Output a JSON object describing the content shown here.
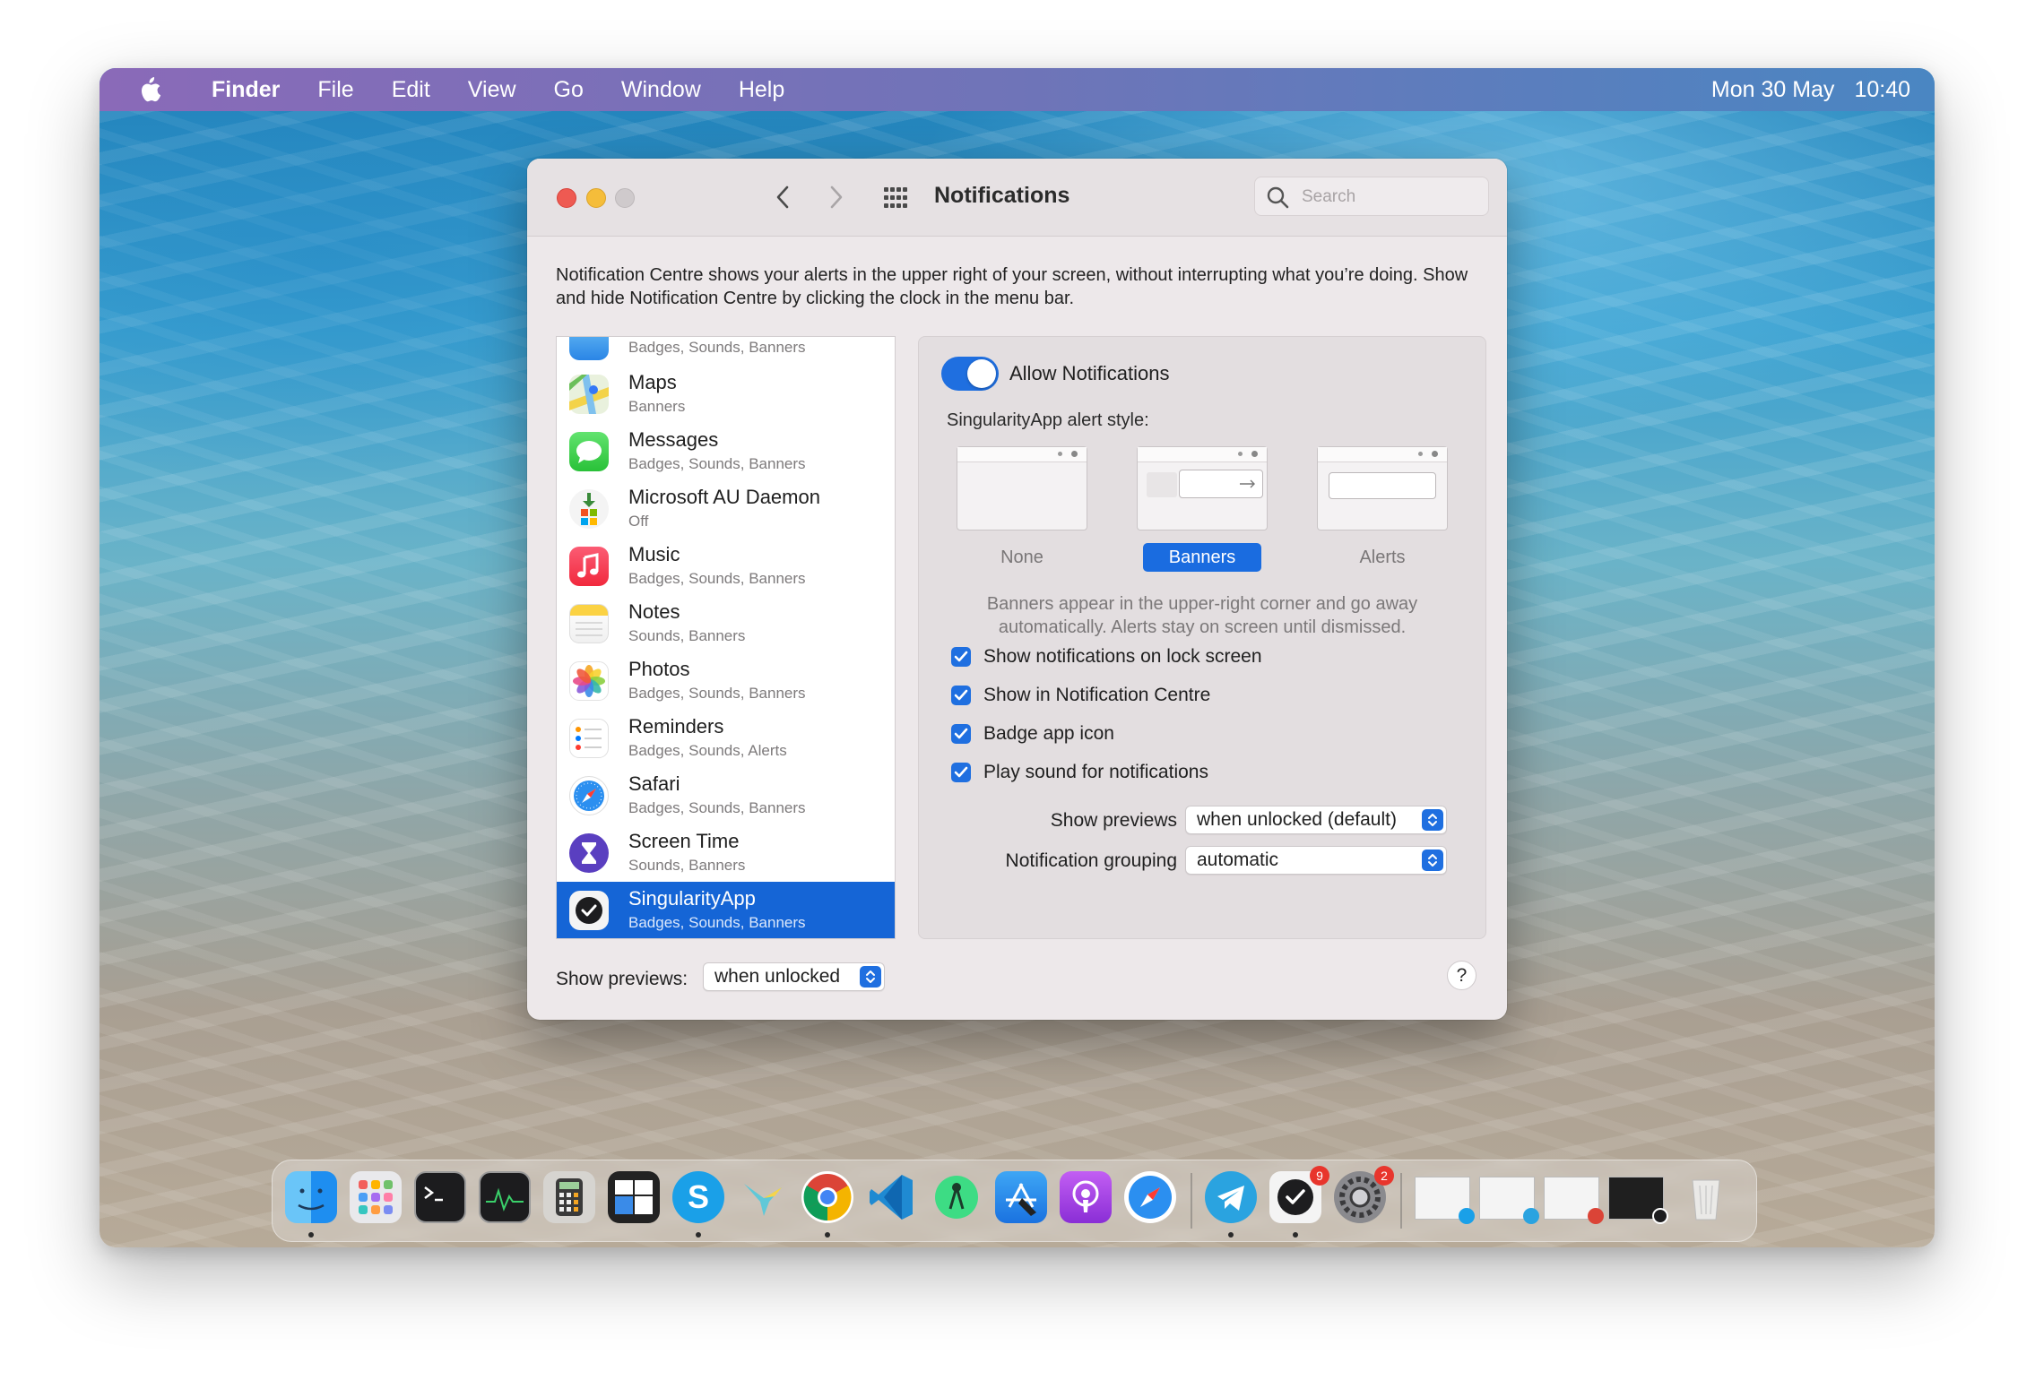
{
  "menubar": {
    "app": "Finder",
    "items": [
      "File",
      "Edit",
      "View",
      "Go",
      "Window",
      "Help"
    ],
    "date": "Mon 30 May",
    "time": "10:40"
  },
  "window": {
    "title": "Notifications",
    "search_placeholder": "Search",
    "description": "Notification Centre shows your alerts in the upper right of your screen, without interrupting what you’re doing. Show and hide Notification Centre by clicking the clock in the menu bar."
  },
  "apps": [
    {
      "name": "",
      "sub": "Badges, Sounds, Banners",
      "icon": "mail-icon"
    },
    {
      "name": "Maps",
      "sub": "Banners",
      "icon": "maps-icon"
    },
    {
      "name": "Messages",
      "sub": "Badges, Sounds, Banners",
      "icon": "messages-icon"
    },
    {
      "name": "Microsoft AU Daemon",
      "sub": "Off",
      "icon": "microsoft-autoupdate-icon"
    },
    {
      "name": "Music",
      "sub": "Badges, Sounds, Banners",
      "icon": "music-icon"
    },
    {
      "name": "Notes",
      "sub": "Sounds, Banners",
      "icon": "notes-icon"
    },
    {
      "name": "Photos",
      "sub": "Badges, Sounds, Banners",
      "icon": "photos-icon"
    },
    {
      "name": "Reminders",
      "sub": "Badges, Sounds, Alerts",
      "icon": "reminders-icon"
    },
    {
      "name": "Safari",
      "sub": "Badges, Sounds, Banners",
      "icon": "safari-icon"
    },
    {
      "name": "Screen Time",
      "sub": "Sounds, Banners",
      "icon": "screen-time-icon"
    },
    {
      "name": "SingularityApp",
      "sub": "Badges, Sounds, Banners",
      "icon": "singularityapp-icon",
      "selected": true
    }
  ],
  "settings": {
    "allow_label": "Allow Notifications",
    "allow_on": true,
    "style_label": "SingularityApp alert style:",
    "styles": [
      "None",
      "Banners",
      "Alerts"
    ],
    "selected_style": "Banners",
    "style_help": "Banners appear in the upper-right corner and go away automatically. Alerts stay on screen until dismissed.",
    "checks": [
      {
        "label": "Show notifications on lock screen",
        "checked": true
      },
      {
        "label": "Show in Notification Centre",
        "checked": true
      },
      {
        "label": "Badge app icon",
        "checked": true
      },
      {
        "label": "Play sound for notifications",
        "checked": true
      }
    ],
    "show_previews_label": "Show previews",
    "show_previews_value": "when unlocked (default)",
    "grouping_label": "Notification grouping",
    "grouping_value": "automatic"
  },
  "footer": {
    "label": "Show previews:",
    "value": "when unlocked",
    "help": "?"
  },
  "dock": {
    "apps": [
      "finder-icon",
      "launchpad-icon",
      "terminal-icon",
      "activity-monitor-icon",
      "calculator-icon",
      "window-manager-icon",
      "skype-icon",
      "hummingbird-icon",
      "chrome-icon",
      "vscode-icon",
      "android-studio-icon",
      "xcode-icon",
      "podcasts-icon",
      "safari-icon",
      "telegram-icon",
      "singularityapp-icon",
      "system-preferences-icon",
      "window-thumbnail-skype",
      "window-thumbnail-telegram",
      "window-thumbnail-chrome",
      "window-thumbnail-singularity",
      "trash-icon"
    ],
    "badges": {
      "singularityapp-icon": "9",
      "system-preferences-icon": "2"
    },
    "colors": {
      "accent": "#1f6fe0",
      "selection": "#1565d6",
      "badge": "#e8352c"
    }
  }
}
